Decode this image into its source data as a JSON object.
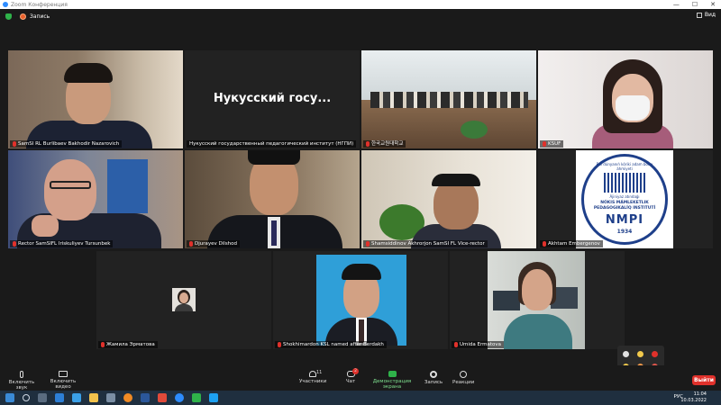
{
  "window": {
    "title": "Zoom Конференция"
  },
  "top": {
    "recording_label": "Запись",
    "view_label": "Вид"
  },
  "tiles": [
    {
      "name": "SamSI RL Burlibaev Bakhodir Nazarovich"
    },
    {
      "name": "Нукусский государственный педагогический институт (НГПИ)",
      "big_label": "Нукусский госу..."
    },
    {
      "name": "한국교원대학교"
    },
    {
      "name": "KSUF"
    },
    {
      "name": "Rector SamSIFL Iriskuliyev Tursunbek"
    },
    {
      "name": "Djurayev Dilshod"
    },
    {
      "name": "Shamsiddinov Akhrorjon SamSI FL Vice-rector"
    },
    {
      "name": "Akhtam Embergenov"
    },
    {
      "name": "Жамила Эрматова"
    },
    {
      "name": "Shokhimardon KSL named after Berdakh"
    },
    {
      "name": "Umida Ermatova"
    }
  ],
  "logo": {
    "top_text": "Bul dúnyanıń kóriki adam bolıw áhmiyeti",
    "mid_text": "Ájiniyaz atındaǵı",
    "line1": "NÓKIS MÁMLEKETLIK",
    "line2": "PEDAGOGIKALÍQ INSTITUTÍ",
    "abbr": "NMPI",
    "year": "1934"
  },
  "toolbar": {
    "mute": "Включить звук",
    "video": "Включить видео",
    "participants": "Участники",
    "participants_count": "11",
    "chat": "Чат",
    "chat_badge": "2",
    "share": "Демонстрация экрана",
    "record": "Запись",
    "reactions": "Реакции",
    "leave": "Выйти"
  },
  "taskbar": {
    "lang": "РУС",
    "time": "11:04",
    "date": "10.03.2022"
  },
  "colors": {
    "active_border": "#9ee85a",
    "leave_red": "#e0312b",
    "share_green": "#2fb24a",
    "zoom_blue": "#2d8cff"
  }
}
